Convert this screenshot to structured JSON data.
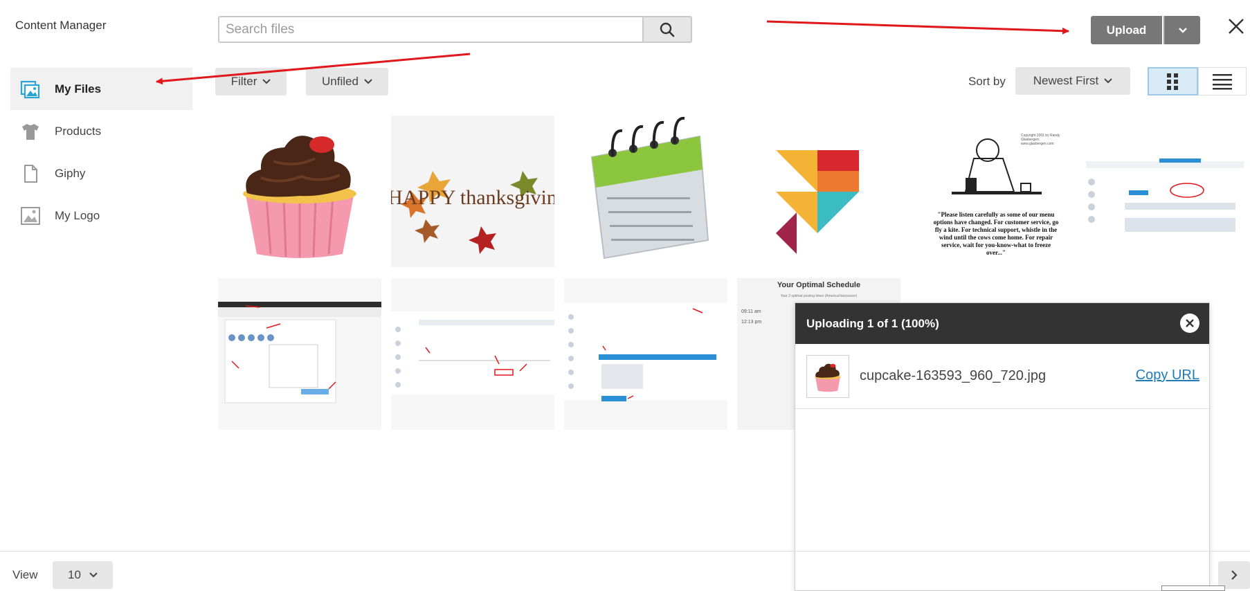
{
  "app": {
    "title": "Content Manager"
  },
  "sidebar": {
    "items": [
      {
        "label": "My Files",
        "icon": "images-icon",
        "active": true
      },
      {
        "label": "Products",
        "icon": "tshirt-icon",
        "active": false
      },
      {
        "label": "Giphy",
        "icon": "document-icon",
        "active": false
      },
      {
        "label": "My Logo",
        "icon": "image-icon",
        "active": false
      }
    ]
  },
  "search": {
    "placeholder": "Search files",
    "value": ""
  },
  "toolbar": {
    "upload_label": "Upload",
    "filter_label": "Filter",
    "unfiled_label": "Unfiled",
    "sort_label": "Sort by",
    "sort_value": "Newest First",
    "view_mode": "grid"
  },
  "grid": {
    "items": [
      {
        "name": "cupcake",
        "caption": ""
      },
      {
        "name": "happy-thanksgiving",
        "caption": "HAPPY thanksgiving"
      },
      {
        "name": "calendar",
        "caption": ""
      },
      {
        "name": "colorful-logo",
        "caption": ""
      },
      {
        "name": "menu-options-cartoon",
        "caption": "\"Please listen carefully as some of our menu options have changed. For customer service, go fly a kite. For technical support, whistle in the wind until the cows come home. For repair service, wait for you-know-what to freeze over...\"",
        "credit": "Copyright 2001 by Randy Glasbergen. www.glasbergen.com"
      },
      {
        "name": "buffer-screenshot-1",
        "caption": ""
      },
      {
        "name": "screenshot-2",
        "caption": ""
      },
      {
        "name": "buffer-screenshot-3",
        "caption": ""
      },
      {
        "name": "schedule-screenshot",
        "caption": ""
      },
      {
        "name": "optimal-schedule",
        "caption": "Your Optimal Schedule",
        "sub": "Your 2 optimal posting times (America/Vancouver)",
        "times": [
          "09:11 am",
          "12:13 pm"
        ]
      }
    ]
  },
  "upload_panel": {
    "title": "Uploading 1 of 1 (100%)",
    "file": "cupcake-163593_960_720.jpg",
    "copy_label": "Copy URL"
  },
  "pager": {
    "view_label": "View",
    "per_page": "10"
  },
  "colors": {
    "accent": "#1f7bb5",
    "upload_btn": "#777777",
    "annotation": "#e0171b"
  }
}
